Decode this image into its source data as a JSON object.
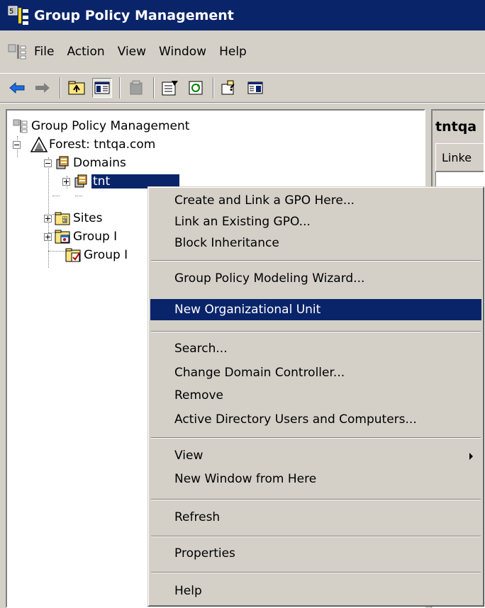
{
  "window": {
    "title": "Group Policy Management"
  },
  "menubar": {
    "items": [
      "File",
      "Action",
      "View",
      "Window",
      "Help"
    ]
  },
  "toolbar": {
    "buttons": [
      "back-icon",
      "forward-icon",
      "up-folder-icon",
      "show-hide-tree-icon",
      "delete-icon",
      "properties-icon",
      "refresh-icon",
      "help-icon",
      "action-pane-icon"
    ]
  },
  "tree": {
    "root": "Group Policy Management",
    "forest": "Forest: tntqa.com",
    "domains": "Domains",
    "domain_node": "tnt",
    "sites": "Sites",
    "group_policy_modeling": "Group I",
    "group_policy_results": "Group I"
  },
  "right_pane": {
    "header": "tntqa",
    "tab": "Linke"
  },
  "context_menu": {
    "groups": [
      [
        "Create and Link a GPO Here...",
        "Link an Existing GPO...",
        "Block Inheritance"
      ],
      [
        "Group Policy Modeling Wizard...",
        "New Organizational Unit"
      ],
      [
        "Search...",
        "Change Domain Controller...",
        "Remove",
        "Active Directory Users and Computers..."
      ],
      [
        "View",
        "New Window from Here"
      ],
      [
        "Refresh"
      ],
      [
        "Properties"
      ],
      [
        "Help"
      ]
    ],
    "highlighted": "New Organizational Unit"
  },
  "colors": {
    "titlebar": "#0a246a",
    "highlight": "#0a246a",
    "face": "#d4d0c8"
  }
}
